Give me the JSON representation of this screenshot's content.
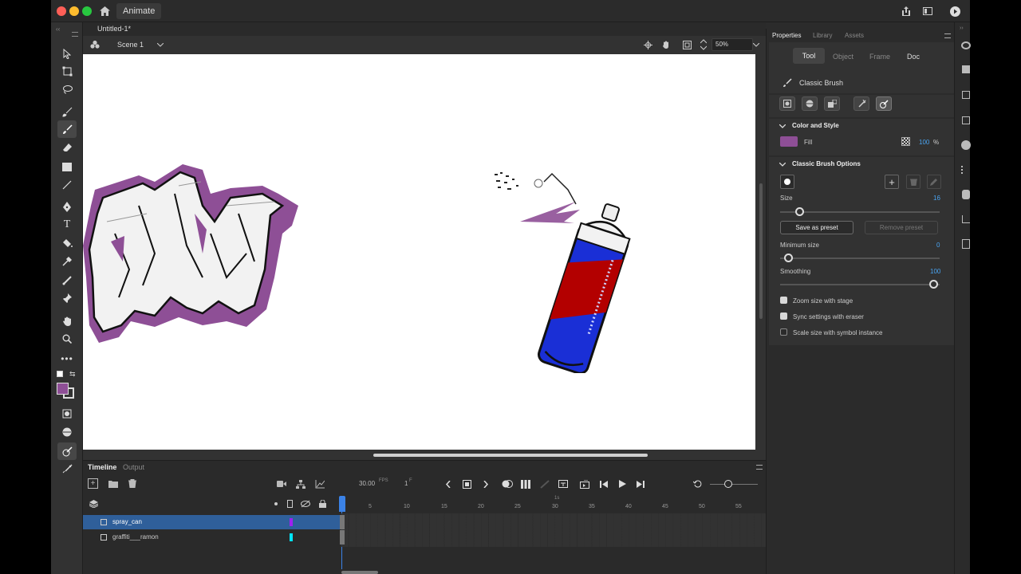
{
  "app": {
    "name": "Animate"
  },
  "document": {
    "title": "Untitled-1*",
    "scene": "Scene 1",
    "zoom": "50%"
  },
  "timeline": {
    "tabs": [
      "Timeline",
      "Output"
    ],
    "fps": "30.00",
    "fps_unit": "FPS",
    "frame": "1",
    "frame_unit": "F",
    "second_marker": "1s",
    "ruler": [
      "5",
      "10",
      "15",
      "20",
      "25",
      "30",
      "35",
      "40",
      "45",
      "50",
      "55"
    ],
    "layers": [
      {
        "name": "spray_can",
        "selected": true,
        "color": "#a020f0"
      },
      {
        "name": "graffiti___ramon",
        "selected": false,
        "color": "#00e5ff"
      }
    ]
  },
  "properties": {
    "tabs": [
      "Properties",
      "Library",
      "Assets"
    ],
    "subtabs": [
      "Tool",
      "Object",
      "Frame",
      "Doc"
    ],
    "tool_name": "Classic Brush",
    "color_style": {
      "header": "Color and Style",
      "fill_label": "Fill",
      "fill_color": "#8e4f96",
      "alpha": "100",
      "alpha_unit": "%"
    },
    "brush_options": {
      "header": "Classic Brush Options",
      "size_label": "Size",
      "size_value": "16",
      "save_preset": "Save as preset",
      "remove_preset": "Remove preset",
      "min_size_label": "Minimum size",
      "min_size_value": "0",
      "smoothing_label": "Smoothing",
      "smoothing_value": "100",
      "checkboxes": [
        {
          "label": "Zoom size with stage",
          "checked": true
        },
        {
          "label": "Sync settings with eraser",
          "checked": true
        },
        {
          "label": "Scale size with symbol instance",
          "checked": false
        }
      ]
    }
  },
  "colors": {
    "accent": "#4aa3f0",
    "selection": "#2f5f9a",
    "graffiti_purple": "#8e4f96",
    "can_blue": "#1a2fd6",
    "can_red": "#b30000"
  }
}
